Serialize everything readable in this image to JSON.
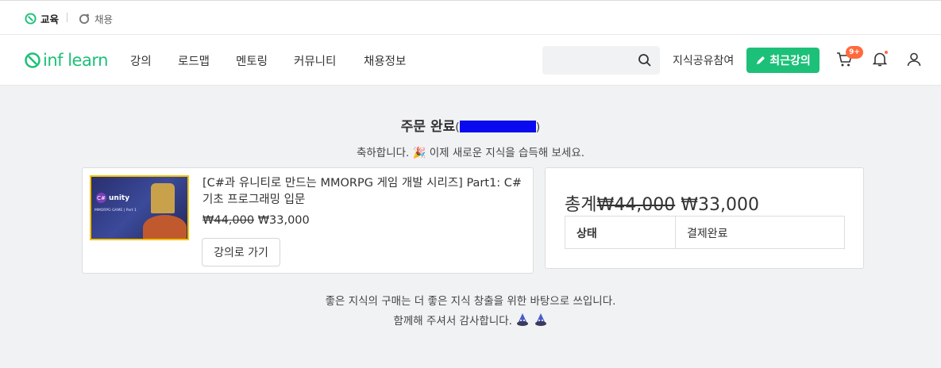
{
  "topbar": {
    "edu_label": "교육",
    "job_label": "채용"
  },
  "nav": {
    "logo_text": "inf learn",
    "menu": [
      "강의",
      "로드맵",
      "멘토링",
      "커뮤니티",
      "채용정보"
    ],
    "share_label": "지식공유참여",
    "recent_label": "최근강의",
    "cart_badge": "9+"
  },
  "order": {
    "title": "주문 완료",
    "congrats": "축하합니다. 🎉 이제 새로운 지식을 습득해 보세요."
  },
  "course": {
    "title": "[C#과 유니티로 만드는 MMORPG 게임 개발 시리즈] Part1: C# 기초 프로그래밍 입문",
    "original_price": "₩44,000",
    "price": "₩33,000",
    "button": "강의로 가기",
    "thumb_unity": "unity",
    "thumb_cs": "C#",
    "thumb_sub": "MMORPG GAME | Part 1"
  },
  "summary": {
    "total_label": "총계",
    "original_price": "₩44,000",
    "price": "₩33,000",
    "status_key": "상태",
    "status_value": "결제완료"
  },
  "footer": {
    "line1": "좋은 지식의 구매는 더 좋은 지식 창출을 위한 바탕으로 쓰입니다.",
    "line2": "함께해 주셔서 감사합니다."
  },
  "colors": {
    "brand": "#1dc078",
    "badge": "#ff6a3d",
    "redaction": "#0a0af0"
  }
}
